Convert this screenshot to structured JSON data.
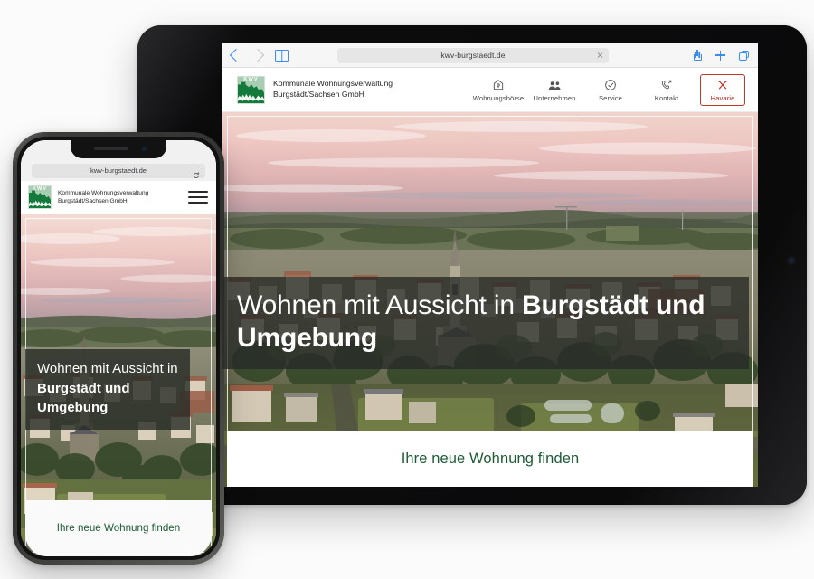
{
  "site": {
    "url": "kwv-burgstaedt.de",
    "brand_line1": "Kommunale Wohnungsverwaltung",
    "brand_line2": "Burgstädt/Sachsen GmbH",
    "logo_text": "KWV",
    "logo_bg_color": "#a8cdb2",
    "logo_mountain_color": "#137a3c",
    "accent_green": "#1c5c34",
    "alarm_red": "#b52b1d"
  },
  "nav": {
    "items": [
      {
        "label": "Wohnungsbörse",
        "icon": "house-tag-icon",
        "highlight": false
      },
      {
        "label": "Unternehmen",
        "icon": "people-icon",
        "highlight": false
      },
      {
        "label": "Service",
        "icon": "check-circle-icon",
        "highlight": false
      },
      {
        "label": "Kontakt",
        "icon": "phone-call-icon",
        "highlight": false
      },
      {
        "label": "Havarie",
        "icon": "tools-cross-icon",
        "highlight": true
      }
    ]
  },
  "hero": {
    "headline_regular": "Wohnen mit Aussicht in ",
    "headline_bold": "Burgstädt und Umgebung",
    "image_alt": "Luftaufnahme von Burgstädt bei Sonnenuntergang",
    "cta_label": "Ihre neue Wohnung finden"
  },
  "tablet_browser": {
    "back_label": "Zurück",
    "forward_label": "Vorwärts",
    "bookmarks_label": "Lesezeichen",
    "share_label": "Teilen",
    "new_tab_label": "Neuer Tab",
    "tabs_label": "Tabs",
    "stop_label": "Laden stoppen"
  },
  "phone_browser": {
    "reload_label": "Neu laden",
    "menu_label": "Menü"
  }
}
